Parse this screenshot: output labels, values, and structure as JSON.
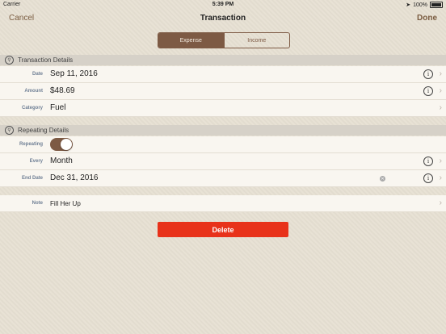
{
  "status_bar": {
    "carrier": "Carrier",
    "time": "5:39 PM",
    "battery": "100%"
  },
  "nav": {
    "cancel": "Cancel",
    "title": "Transaction",
    "done": "Done"
  },
  "segments": {
    "expense": "Expense",
    "income": "Income",
    "selected": "Expense"
  },
  "transaction_details": {
    "header": "Transaction Details",
    "date_label": "Date",
    "date_value": "Sep 11, 2016",
    "amount_label": "Amount",
    "amount_value": "$48.69",
    "category_label": "Category",
    "category_value": "Fuel"
  },
  "repeating_details": {
    "header": "Repeating Details",
    "repeating_label": "Repeating",
    "repeating_on": true,
    "every_label": "Every",
    "every_value": "Month",
    "end_date_label": "End Date",
    "end_date_value": "Dec 31, 2016"
  },
  "note": {
    "label": "Note",
    "value": "Fill Her Up"
  },
  "delete_label": "Delete",
  "colors": {
    "accent": "#7d5a44",
    "delete": "#e8321a",
    "label": "#6f7f95"
  }
}
